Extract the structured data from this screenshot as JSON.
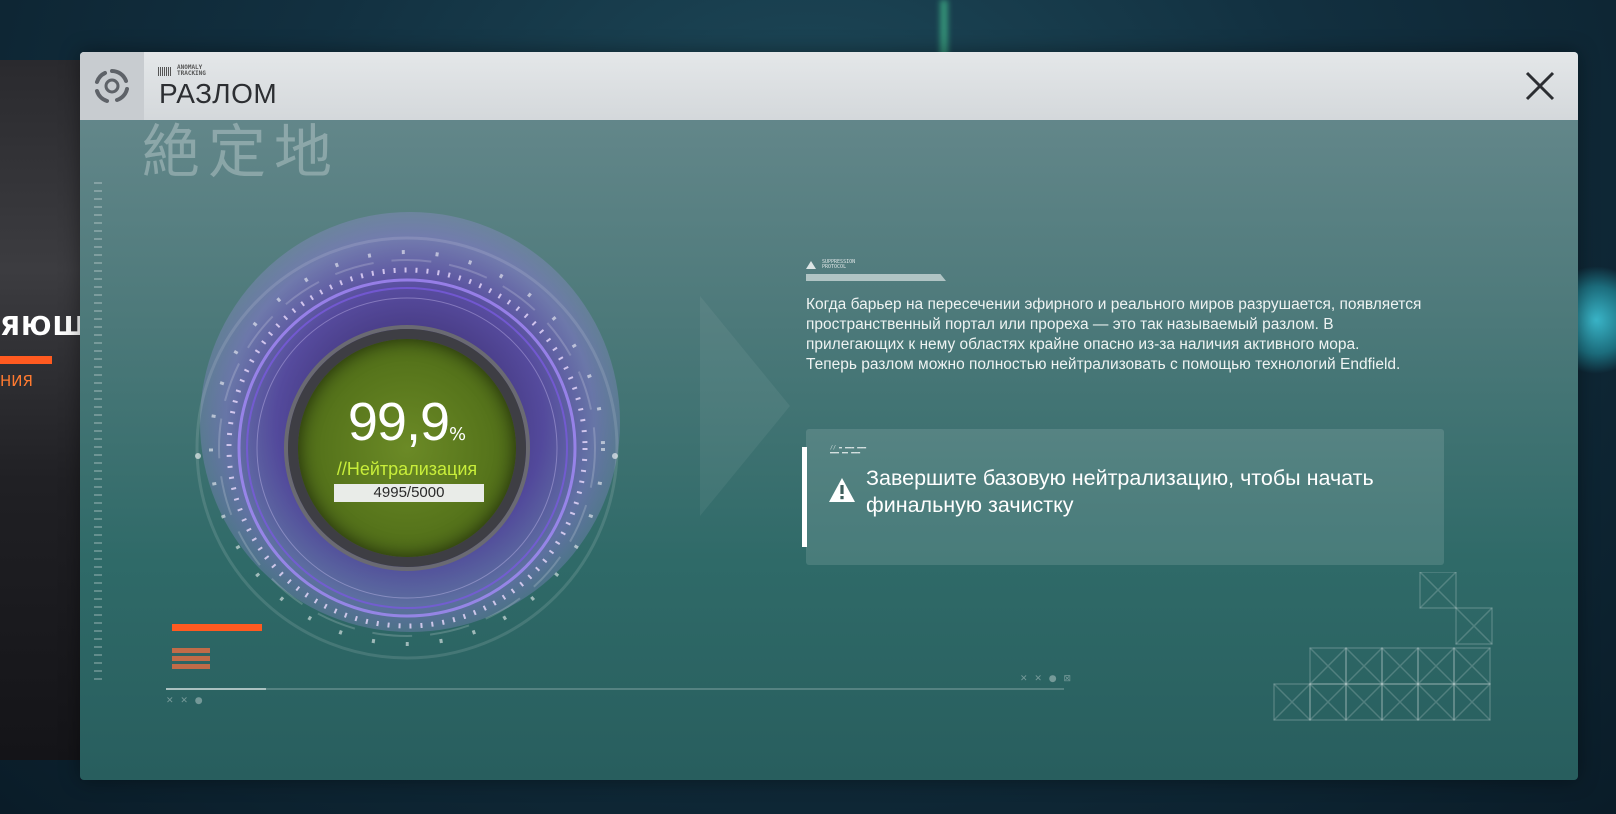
{
  "window": {
    "subtitle": "ANOMALY\nTRACKING",
    "title": "РАЗЛОМ",
    "close_label": "✕"
  },
  "background": {
    "left_text": "ЯЮЩ",
    "left_subtext": "НИЯ"
  },
  "decor": {
    "glyphs_text": "絶定地"
  },
  "progress": {
    "percent_value": "99,9",
    "percent_sign": "%",
    "label": "//Нейтрализация",
    "counter": "4995/5000",
    "fraction": 0.999
  },
  "info": {
    "tag_text": "SUPPRESSION\nPROTOCOL",
    "paragraph_1": "Когда барьер на пересечении эфирного и реального миров разрушается, появляется пространственный портал или прореха — это так называемый разлом. В прилегающих к нему областях крайне опасно из-за наличия активного мора.",
    "paragraph_2": "Теперь разлом можно полностью нейтрализовать с помощью технологий Endfield."
  },
  "notice": {
    "tag_text": "// ▬ ▬▬▬ ▬▬▬\n▬▬▬ ▬▬ ▬▬▬",
    "warning_icon": "warning-triangle-icon",
    "message": "Завершите базовую нейтрализацию, чтобы начать финальную зачистку"
  },
  "colors": {
    "accent_green": "#c8ee3a",
    "core_green": "#56741b",
    "ring_purple": "#9a7aff",
    "accent_orange": "#ff5a20"
  }
}
